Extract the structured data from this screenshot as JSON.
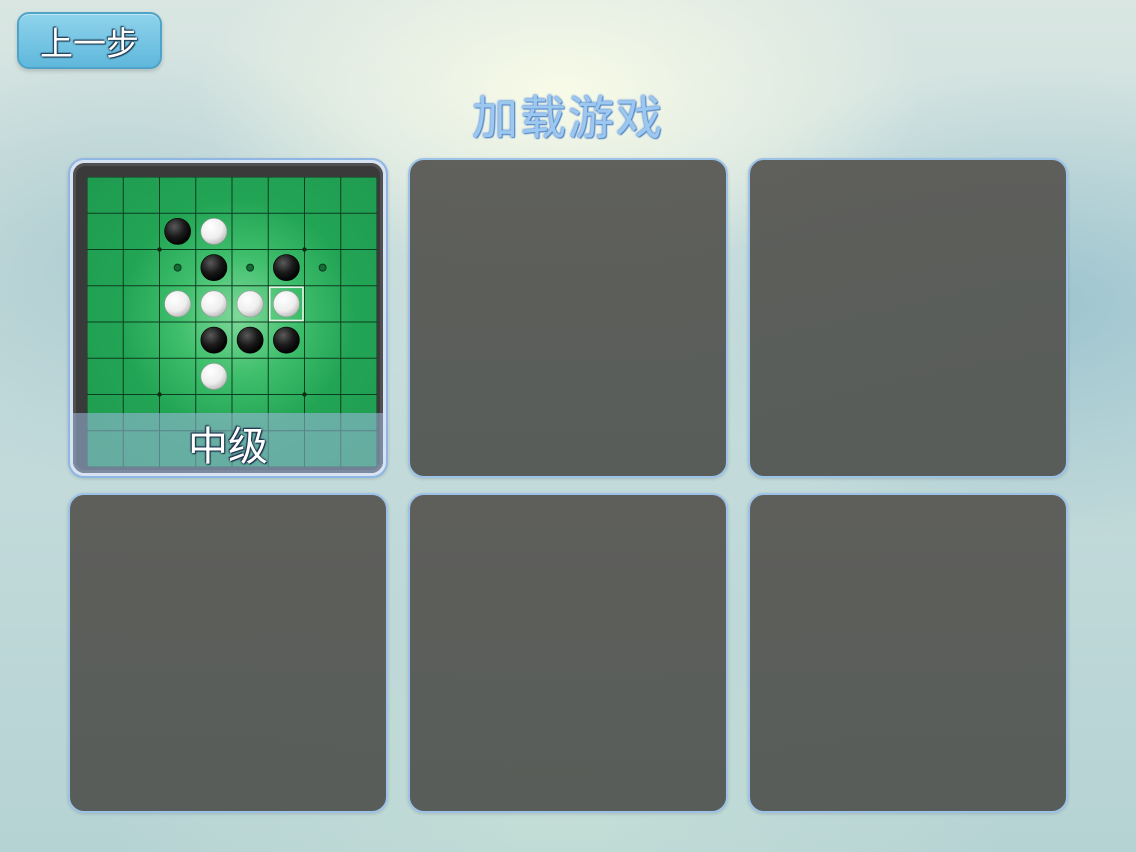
{
  "header": {
    "back_label": "上一步",
    "title": "加载游戏"
  },
  "slots": [
    {
      "filled": true,
      "level_label": "中级",
      "board": {
        "size": 8,
        "pieces": [
          {
            "row": 1,
            "col": 2,
            "color": "black"
          },
          {
            "row": 1,
            "col": 3,
            "color": "white"
          },
          {
            "row": 2,
            "col": 3,
            "color": "black"
          },
          {
            "row": 2,
            "col": 5,
            "color": "black"
          },
          {
            "row": 3,
            "col": 2,
            "color": "white"
          },
          {
            "row": 3,
            "col": 3,
            "color": "white"
          },
          {
            "row": 3,
            "col": 4,
            "color": "white"
          },
          {
            "row": 3,
            "col": 5,
            "color": "white"
          },
          {
            "row": 4,
            "col": 3,
            "color": "black"
          },
          {
            "row": 4,
            "col": 4,
            "color": "black"
          },
          {
            "row": 4,
            "col": 5,
            "color": "black"
          },
          {
            "row": 5,
            "col": 3,
            "color": "white"
          }
        ],
        "last_move": {
          "row": 3,
          "col": 5
        },
        "hints": [
          {
            "row": 2,
            "col": 2
          },
          {
            "row": 2,
            "col": 4
          },
          {
            "row": 2,
            "col": 6
          }
        ]
      }
    },
    {
      "filled": false
    },
    {
      "filled": false
    },
    {
      "filled": false
    },
    {
      "filled": false
    },
    {
      "filled": false
    }
  ],
  "colors": {
    "board_green": "#22a455",
    "grid_line": "#0d3d1f",
    "empty_slot": "#5a5a56",
    "slot_border": "#9cc2e8",
    "title_blue": "#9cc8f0"
  }
}
